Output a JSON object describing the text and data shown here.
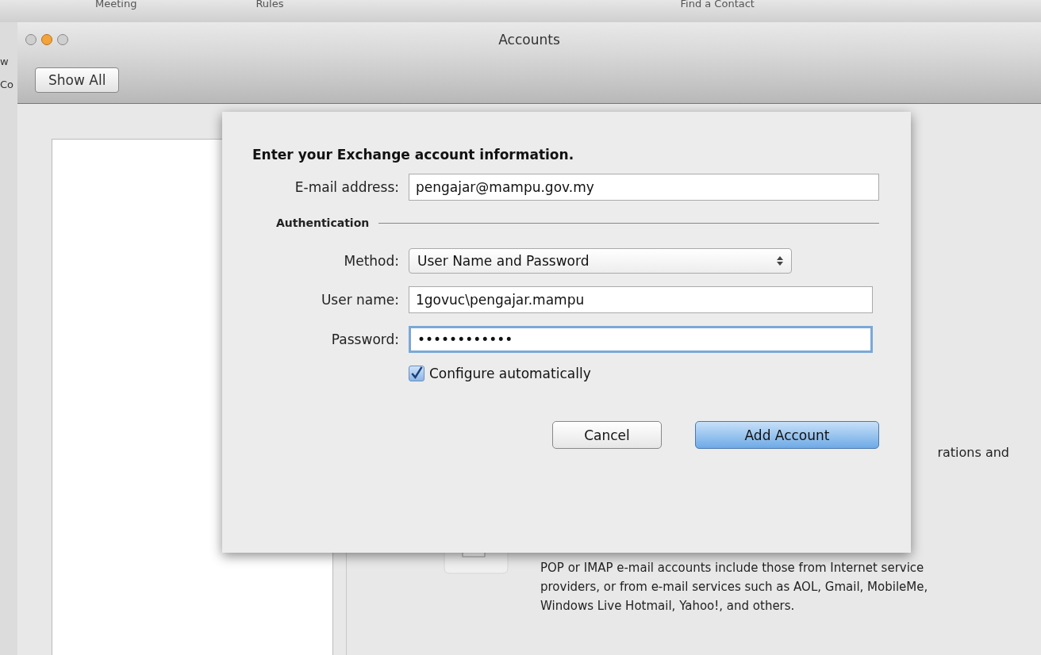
{
  "background_app": {
    "toolbar_items": [
      "Meeting",
      "Rules",
      "Find a Contact"
    ],
    "side_fragments": [
      "w",
      "Co"
    ]
  },
  "window": {
    "title": "Accounts",
    "show_all": "Show All"
  },
  "behind_sheet": {
    "fragment": "rations and",
    "description": "POP or IMAP e-mail accounts include those from Internet service providers, or from e-mail services such as AOL, Gmail, MobileMe, Windows Live Hotmail, Yahoo!, and others."
  },
  "sheet": {
    "heading": "Enter your Exchange account information.",
    "email": {
      "label": "E-mail address:",
      "value": "pengajar@mampu.gov.my"
    },
    "section": "Authentication",
    "method": {
      "label": "Method:",
      "value": "User Name and Password"
    },
    "username": {
      "label": "User name:",
      "value": "1govuc\\pengajar.mampu",
      "focused": false
    },
    "password": {
      "label": "Password:",
      "value": "••••••••••••",
      "focused": true
    },
    "configure": {
      "label": "Configure automatically",
      "checked": true
    },
    "buttons": [
      {
        "label": "Cancel",
        "default": false
      },
      {
        "label": "Add Account",
        "default": true
      }
    ]
  }
}
